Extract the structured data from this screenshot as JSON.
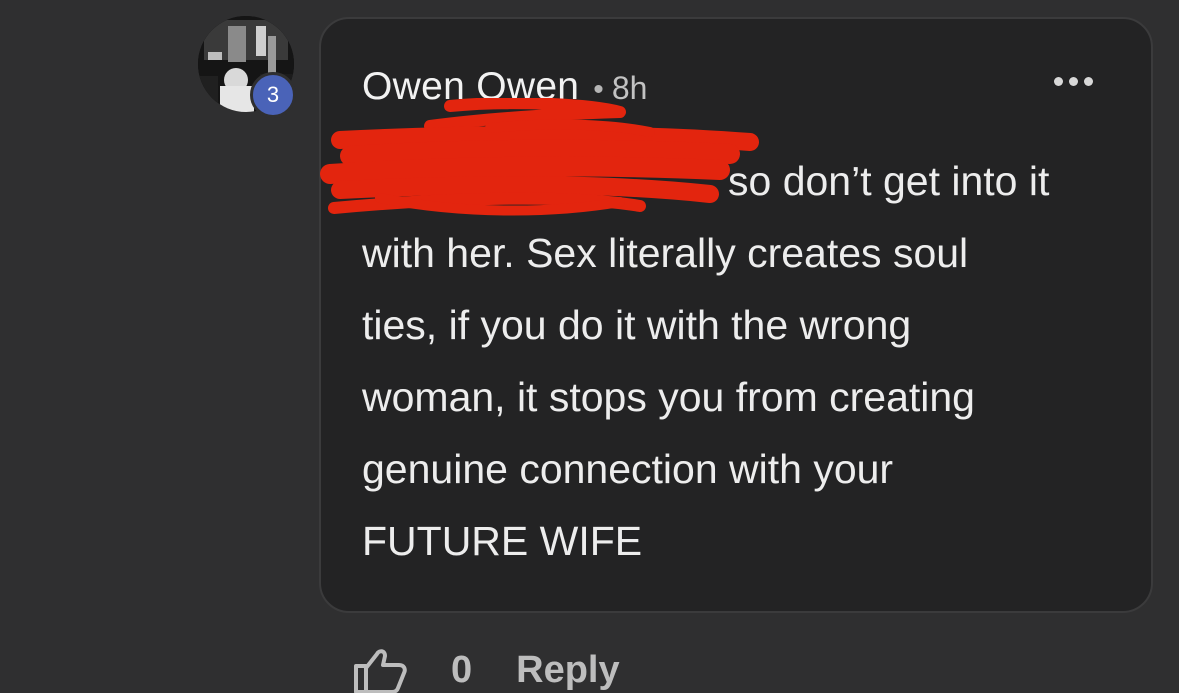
{
  "comment": {
    "author": "Owen Owen",
    "separator": "•",
    "time": "8h",
    "badge_count": "3",
    "text_lines": [
      "so don’t get into it",
      "with her. Sex literally creates soul",
      "ties, if you do it with the wrong",
      "woman, it stops you from creating",
      "genuine connection with your",
      "FUTURE WIFE"
    ]
  },
  "actions": {
    "like_count": "0",
    "reply_label": "Reply"
  },
  "colors": {
    "background": "#2f2f30",
    "bubble": "#232324",
    "badge": "#4a63b8",
    "redaction": "#e3250e"
  },
  "icons": {
    "more": "more-horizontal-icon",
    "like": "thumbs-up-icon"
  }
}
